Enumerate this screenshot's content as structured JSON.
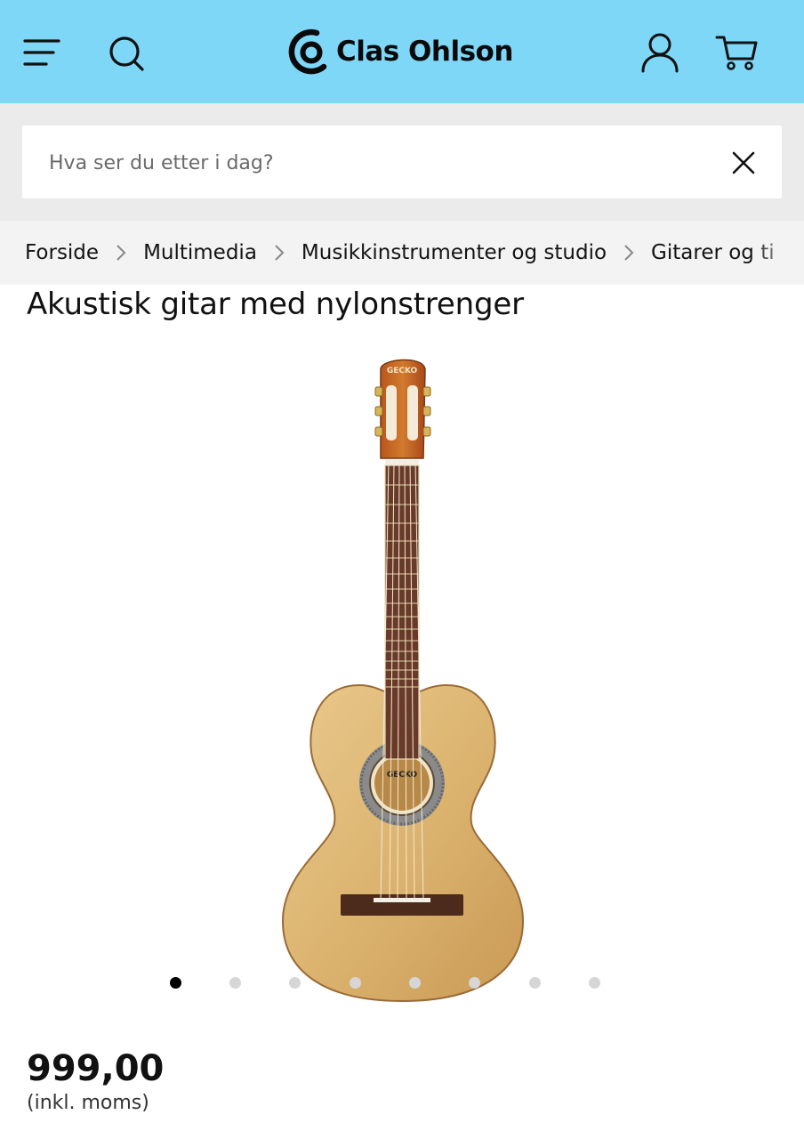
{
  "header": {
    "brand": "Clas Ohlson",
    "menu_icon": "menu-icon",
    "search_icon": "search-icon",
    "account_icon": "user-icon",
    "cart_icon": "cart-icon",
    "background": "#7fd7f7"
  },
  "search": {
    "placeholder": "Hva ser du etter i dag?",
    "value": "",
    "clear_icon": "close-icon"
  },
  "breadcrumb": [
    {
      "label": "Forside"
    },
    {
      "label": "Multimedia"
    },
    {
      "label": "Musikkinstrumenter og studio"
    },
    {
      "label": "Gitarer og ti"
    }
  ],
  "product": {
    "title": "Akustisk gitar med nylonstrenger",
    "headstock_brand": "GECKO",
    "price": "999,00",
    "vat_note": "(inkl. moms)"
  },
  "carousel": {
    "total": 8,
    "active_index": 1
  }
}
